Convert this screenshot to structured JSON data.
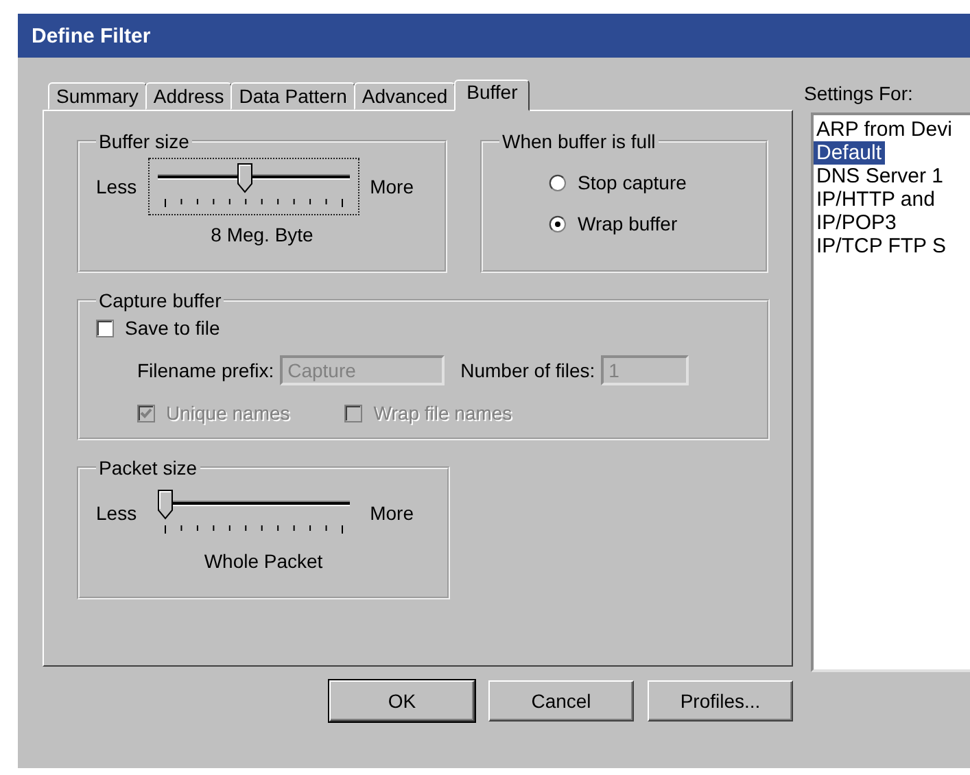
{
  "window": {
    "title": "Define Filter"
  },
  "tabs": [
    {
      "label": "Summary",
      "selected": false
    },
    {
      "label": "Address",
      "selected": false
    },
    {
      "label": "Data Pattern",
      "selected": false
    },
    {
      "label": "Advanced",
      "selected": false
    },
    {
      "label": "Buffer",
      "selected": true
    }
  ],
  "buffer_size": {
    "title": "Buffer size",
    "min_label": "Less",
    "max_label": "More",
    "level": 0.45,
    "focused": true,
    "reading": "8 Meg. Byte"
  },
  "when_full": {
    "title": "When buffer is full",
    "options": [
      {
        "label": "Stop capture",
        "selected": false
      },
      {
        "label": "Wrap buffer",
        "selected": true
      }
    ]
  },
  "capture_buffer": {
    "title": "Capture buffer",
    "save_to_file": {
      "label": "Save to file",
      "checked": false,
      "disabled": false
    },
    "filename_prefix": {
      "label": "Filename prefix:",
      "value": "Capture",
      "disabled": true
    },
    "number_of_files": {
      "label": "Number of files:",
      "value": "1",
      "disabled": true
    },
    "options": [
      {
        "label": "Unique names",
        "checked": true,
        "disabled": true
      },
      {
        "label": "Wrap file names",
        "checked": false,
        "disabled": true
      }
    ]
  },
  "packet_size": {
    "title": "Packet size",
    "min_label": "Less",
    "max_label": "More",
    "level": 0,
    "focused": false,
    "reading": "Whole Packet"
  },
  "settings": {
    "label": "Settings For:",
    "items": [
      {
        "label": "ARP from Devi",
        "selected": false
      },
      {
        "label": "Default",
        "selected": true
      },
      {
        "label": "DNS Server 1",
        "selected": false
      },
      {
        "label": "IP/HTTP and",
        "selected": false
      },
      {
        "label": "IP/POP3",
        "selected": false
      },
      {
        "label": "IP/TCP FTP S",
        "selected": false
      }
    ]
  },
  "buttons": [
    {
      "label": "OK",
      "default": true
    },
    {
      "label": "Cancel",
      "default": false
    },
    {
      "label": "Profiles...",
      "default": false
    }
  ]
}
